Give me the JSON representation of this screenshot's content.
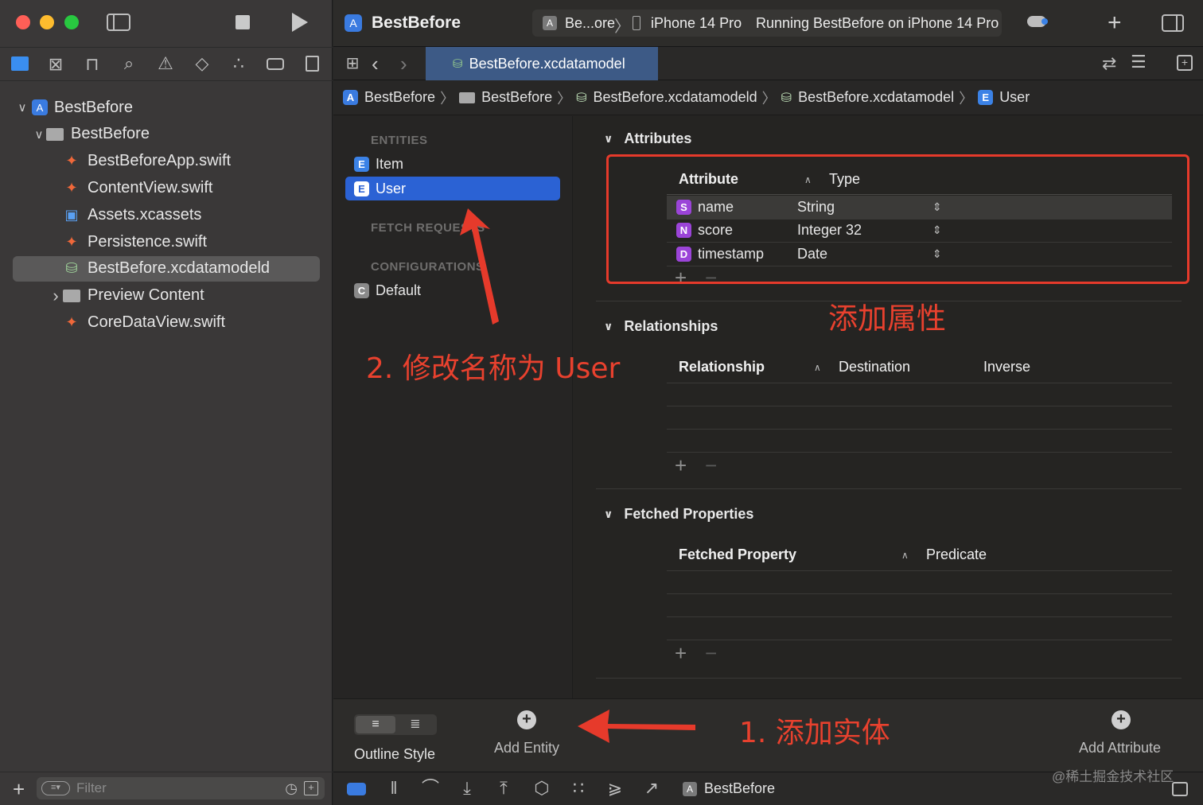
{
  "window": {
    "traffic_lights": {
      "close": "#ff5f57",
      "minimize": "#febc2e",
      "zoom": "#28c840"
    }
  },
  "sidebar": {
    "tree": [
      {
        "label": "BestBefore",
        "level": 0,
        "expanded": true,
        "icon": "xcode-project-icon"
      },
      {
        "label": "BestBefore",
        "level": 1,
        "expanded": true,
        "icon": "folder-icon"
      },
      {
        "label": "BestBeforeApp.swift",
        "level": 2,
        "icon": "swift-icon"
      },
      {
        "label": "ContentView.swift",
        "level": 2,
        "icon": "swift-icon"
      },
      {
        "label": "Assets.xcassets",
        "level": 2,
        "icon": "assets-icon"
      },
      {
        "label": "Persistence.swift",
        "level": 2,
        "icon": "swift-icon"
      },
      {
        "label": "BestBefore.xcdatamodeld",
        "level": 2,
        "icon": "datamodel-icon",
        "selected": true
      },
      {
        "label": "Preview Content",
        "level": 2,
        "expanded": false,
        "icon": "folder-icon"
      },
      {
        "label": "CoreDataView.swift",
        "level": 2,
        "icon": "swift-icon"
      }
    ],
    "filter_placeholder": "Filter"
  },
  "toolbar": {
    "project_name": "BestBefore",
    "scheme_short": "Be...ore",
    "device": "iPhone 14 Pro",
    "status": "Running BestBefore on iPhone 14 Pro"
  },
  "tabbar": {
    "active_tab": "BestBefore.xcdatamodel"
  },
  "jumpbar": {
    "segments": [
      "BestBefore",
      "BestBefore",
      "BestBefore.xcdatamodeld",
      "BestBefore.xcdatamodel",
      "User"
    ]
  },
  "entities_panel": {
    "entities_header": "ENTITIES",
    "entities": [
      {
        "badge": "E",
        "name": "Item"
      },
      {
        "badge": "E",
        "name": "User",
        "selected": true
      }
    ],
    "fetch_header": "FETCH REQUESTS",
    "config_header": "CONFIGURATIONS",
    "configurations": [
      {
        "badge": "C",
        "name": "Default"
      }
    ]
  },
  "attributes": {
    "section_title": "Attributes",
    "col_attribute": "Attribute",
    "col_type": "Type",
    "rows": [
      {
        "badge": "S",
        "name": "name",
        "type": "String"
      },
      {
        "badge": "N",
        "name": "score",
        "type": "Integer 32"
      },
      {
        "badge": "D",
        "name": "timestamp",
        "type": "Date"
      }
    ]
  },
  "relationships": {
    "section_title": "Relationships",
    "col_relationship": "Relationship",
    "col_destination": "Destination",
    "col_inverse": "Inverse"
  },
  "fetched": {
    "section_title": "Fetched Properties",
    "col_property": "Fetched Property",
    "col_predicate": "Predicate"
  },
  "bottombar": {
    "outline_style": "Outline Style",
    "add_entity": "Add Entity",
    "add_attribute": "Add Attribute"
  },
  "debugbar": {
    "target": "BestBefore"
  },
  "annotations": {
    "step1": "1. 添加实体",
    "step2": "2. 修改名称为 User",
    "add_attr": "添加属性",
    "color": "#e63a2b"
  },
  "watermark": "@稀土掘金技术社区"
}
